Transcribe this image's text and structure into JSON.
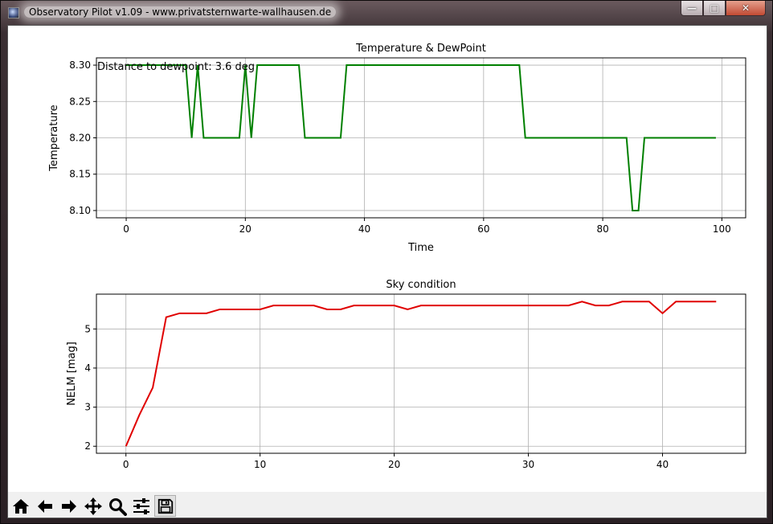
{
  "window": {
    "title": "Observatory Pilot v1.09 - www.privatsternwarte-wallhausen.de",
    "minimize_label": "—",
    "maximize_label": "□",
    "close_label": "✕"
  },
  "toolbar": {
    "items": [
      "home-icon",
      "back-icon",
      "forward-icon",
      "pan-icon",
      "zoom-icon",
      "configure-subplots-icon",
      "save-icon"
    ]
  },
  "chart_data": [
    {
      "type": "line",
      "title": "Temperature & DewPoint",
      "xlabel": "Time",
      "ylabel": "Temperature",
      "annotation": "Distance to dewpoint: 3.6 deg",
      "color": "#008000",
      "grid": true,
      "xlim": [
        -5,
        104
      ],
      "ylim": [
        8.09,
        8.31
      ],
      "xticks": [
        0,
        20,
        40,
        60,
        80,
        100
      ],
      "xtick_labels": [
        "0",
        "20",
        "40",
        "60",
        "80",
        "100"
      ],
      "yticks": [
        8.1,
        8.15,
        8.2,
        8.25,
        8.3
      ],
      "ytick_labels": [
        "8.10",
        "8.15",
        "8.20",
        "8.25",
        "8.30"
      ],
      "x": [
        0,
        1,
        2,
        3,
        4,
        5,
        6,
        7,
        8,
        9,
        10,
        11,
        12,
        13,
        14,
        15,
        16,
        17,
        18,
        19,
        20,
        21,
        22,
        23,
        24,
        25,
        26,
        27,
        28,
        29,
        30,
        31,
        32,
        33,
        34,
        35,
        36,
        37,
        38,
        39,
        40,
        41,
        42,
        43,
        44,
        45,
        46,
        47,
        48,
        49,
        50,
        51,
        52,
        53,
        54,
        55,
        56,
        57,
        58,
        59,
        60,
        61,
        62,
        63,
        64,
        65,
        66,
        67,
        68,
        69,
        70,
        71,
        72,
        73,
        74,
        75,
        76,
        77,
        78,
        79,
        80,
        81,
        82,
        83,
        84,
        85,
        86,
        87,
        88,
        89,
        90,
        91,
        92,
        93,
        94,
        95,
        96,
        97,
        98,
        99
      ],
      "y": [
        8.3,
        8.3,
        8.3,
        8.3,
        8.3,
        8.3,
        8.3,
        8.3,
        8.3,
        8.3,
        8.3,
        8.2,
        8.3,
        8.2,
        8.2,
        8.2,
        8.2,
        8.2,
        8.2,
        8.2,
        8.3,
        8.2,
        8.3,
        8.3,
        8.3,
        8.3,
        8.3,
        8.3,
        8.3,
        8.3,
        8.2,
        8.2,
        8.2,
        8.2,
        8.2,
        8.2,
        8.2,
        8.3,
        8.3,
        8.3,
        8.3,
        8.3,
        8.3,
        8.3,
        8.3,
        8.3,
        8.3,
        8.3,
        8.3,
        8.3,
        8.3,
        8.3,
        8.3,
        8.3,
        8.3,
        8.3,
        8.3,
        8.3,
        8.3,
        8.3,
        8.3,
        8.3,
        8.3,
        8.3,
        8.3,
        8.3,
        8.3,
        8.2,
        8.2,
        8.2,
        8.2,
        8.2,
        8.2,
        8.2,
        8.2,
        8.2,
        8.2,
        8.2,
        8.2,
        8.2,
        8.2,
        8.2,
        8.2,
        8.2,
        8.2,
        8.1,
        8.1,
        8.2,
        8.2,
        8.2,
        8.2,
        8.2,
        8.2,
        8.2,
        8.2,
        8.2,
        8.2,
        8.2,
        8.2,
        8.2
      ]
    },
    {
      "type": "line",
      "title": "Sky condition",
      "xlabel": "",
      "ylabel": "NELM [mag]",
      "color": "#e00000",
      "grid": true,
      "xlim": [
        -2.2,
        46.2
      ],
      "ylim": [
        1.82,
        5.89
      ],
      "xticks": [
        0,
        10,
        20,
        30,
        40
      ],
      "xtick_labels": [
        "0",
        "10",
        "20",
        "30",
        "40"
      ],
      "yticks": [
        2,
        3,
        4,
        5
      ],
      "ytick_labels": [
        "2",
        "3",
        "4",
        "5"
      ],
      "x": [
        0,
        1,
        2,
        3,
        4,
        5,
        6,
        7,
        8,
        9,
        10,
        11,
        12,
        13,
        14,
        15,
        16,
        17,
        18,
        19,
        20,
        21,
        22,
        23,
        24,
        25,
        26,
        27,
        28,
        29,
        30,
        31,
        32,
        33,
        34,
        35,
        36,
        37,
        38,
        39,
        40,
        41,
        42,
        43,
        44
      ],
      "y": [
        2.0,
        2.8,
        3.5,
        5.3,
        5.4,
        5.4,
        5.4,
        5.5,
        5.5,
        5.5,
        5.5,
        5.6,
        5.6,
        5.6,
        5.6,
        5.5,
        5.5,
        5.6,
        5.6,
        5.6,
        5.6,
        5.5,
        5.6,
        5.6,
        5.6,
        5.6,
        5.6,
        5.6,
        5.6,
        5.6,
        5.6,
        5.6,
        5.6,
        5.6,
        5.7,
        5.6,
        5.6,
        5.7,
        5.7,
        5.7,
        5.4,
        5.7,
        5.7,
        5.7,
        5.7
      ]
    }
  ]
}
